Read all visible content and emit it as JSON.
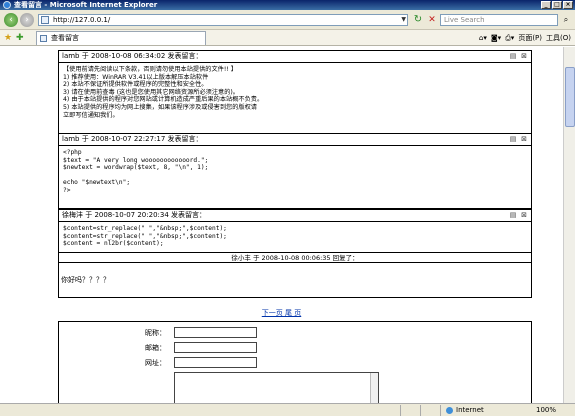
{
  "window": {
    "title": "查看留言 - Microsoft Internet Explorer",
    "buttons": [
      "_",
      "□",
      "×"
    ]
  },
  "address_bar": {
    "url": "http://127.0.0.1/"
  },
  "search": {
    "placeholder": "Live Search"
  },
  "tab": {
    "label": "查看留言"
  },
  "commands": {
    "page": "页面(P)",
    "tools": "工具(O)"
  },
  "posts": [
    {
      "header": "lamb 于 2008-10-08 06:34:02 发表留言：",
      "body": "【使用前请先阅读以下条款，否则请勿使用本站提供的文件!! 】\n1) 推荐使用：WinRAR V3.41以上版本解压本站软件\n2) 本站不保证所提供软件或程序的完整性和安全性。\n3) 请在使用前查毒 (这也是您使用其它网络资源所必须注意的)。\n4) 由于本站提供的程序对您网站或计算机造成严重后果的本站概不负责。\n5) 本站提供的程序均为网上搜集，如果该程序涉及或侵害到您的版权请\n立即写信通知我们。"
    },
    {
      "header": "lamb 于 2008-10-07 22:27:17 发表留言：",
      "body": "<?php\n$text = \"A very long woooooooooooord.\";\n$newtext = wordwrap($text, 8, \"\\n\", 1);\n\necho \"$newtext\\n\";\n?>"
    },
    {
      "header": "徐梅沣 于 2008-10-07 20:20:34 发表留言：",
      "body": "$content=str_replace(\" \",\"&nbsp;\",$content);\n$content=str_replace(\" \",\"&nbsp;\",$content);\n$content = nl2br($content);",
      "reply_header": "徐小丰 于 2008-10-08 00:06:35 回复了：",
      "reply_body": "你好吗？？？？"
    }
  ],
  "pager": {
    "label": "下一页 尾 页"
  },
  "form": {
    "nickname_label": "昵称：",
    "email_label": "邮箱：",
    "site_label": "网址："
  },
  "status": {
    "zone": "Internet",
    "zoom": "100%"
  }
}
